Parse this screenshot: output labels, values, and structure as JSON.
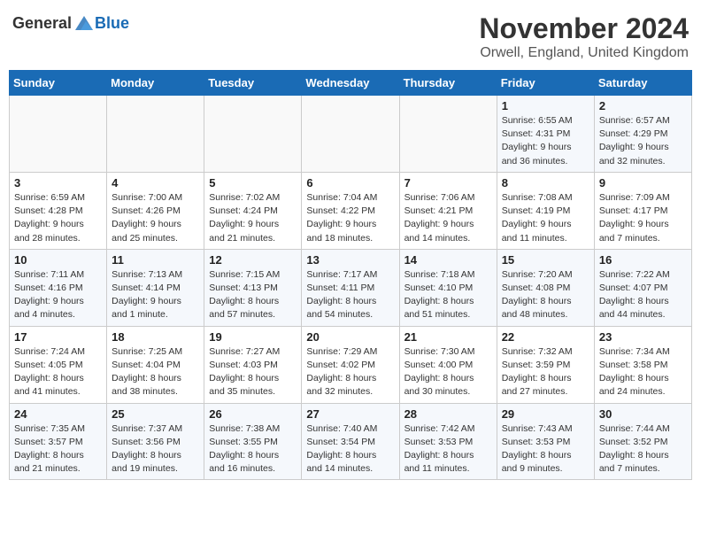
{
  "logo": {
    "text_general": "General",
    "text_blue": "Blue"
  },
  "title": "November 2024",
  "location": "Orwell, England, United Kingdom",
  "weekdays": [
    "Sunday",
    "Monday",
    "Tuesday",
    "Wednesday",
    "Thursday",
    "Friday",
    "Saturday"
  ],
  "weeks": [
    [
      {
        "day": "",
        "detail": ""
      },
      {
        "day": "",
        "detail": ""
      },
      {
        "day": "",
        "detail": ""
      },
      {
        "day": "",
        "detail": ""
      },
      {
        "day": "",
        "detail": ""
      },
      {
        "day": "1",
        "detail": "Sunrise: 6:55 AM\nSunset: 4:31 PM\nDaylight: 9 hours\nand 36 minutes."
      },
      {
        "day": "2",
        "detail": "Sunrise: 6:57 AM\nSunset: 4:29 PM\nDaylight: 9 hours\nand 32 minutes."
      }
    ],
    [
      {
        "day": "3",
        "detail": "Sunrise: 6:59 AM\nSunset: 4:28 PM\nDaylight: 9 hours\nand 28 minutes."
      },
      {
        "day": "4",
        "detail": "Sunrise: 7:00 AM\nSunset: 4:26 PM\nDaylight: 9 hours\nand 25 minutes."
      },
      {
        "day": "5",
        "detail": "Sunrise: 7:02 AM\nSunset: 4:24 PM\nDaylight: 9 hours\nand 21 minutes."
      },
      {
        "day": "6",
        "detail": "Sunrise: 7:04 AM\nSunset: 4:22 PM\nDaylight: 9 hours\nand 18 minutes."
      },
      {
        "day": "7",
        "detail": "Sunrise: 7:06 AM\nSunset: 4:21 PM\nDaylight: 9 hours\nand 14 minutes."
      },
      {
        "day": "8",
        "detail": "Sunrise: 7:08 AM\nSunset: 4:19 PM\nDaylight: 9 hours\nand 11 minutes."
      },
      {
        "day": "9",
        "detail": "Sunrise: 7:09 AM\nSunset: 4:17 PM\nDaylight: 9 hours\nand 7 minutes."
      }
    ],
    [
      {
        "day": "10",
        "detail": "Sunrise: 7:11 AM\nSunset: 4:16 PM\nDaylight: 9 hours\nand 4 minutes."
      },
      {
        "day": "11",
        "detail": "Sunrise: 7:13 AM\nSunset: 4:14 PM\nDaylight: 9 hours\nand 1 minute."
      },
      {
        "day": "12",
        "detail": "Sunrise: 7:15 AM\nSunset: 4:13 PM\nDaylight: 8 hours\nand 57 minutes."
      },
      {
        "day": "13",
        "detail": "Sunrise: 7:17 AM\nSunset: 4:11 PM\nDaylight: 8 hours\nand 54 minutes."
      },
      {
        "day": "14",
        "detail": "Sunrise: 7:18 AM\nSunset: 4:10 PM\nDaylight: 8 hours\nand 51 minutes."
      },
      {
        "day": "15",
        "detail": "Sunrise: 7:20 AM\nSunset: 4:08 PM\nDaylight: 8 hours\nand 48 minutes."
      },
      {
        "day": "16",
        "detail": "Sunrise: 7:22 AM\nSunset: 4:07 PM\nDaylight: 8 hours\nand 44 minutes."
      }
    ],
    [
      {
        "day": "17",
        "detail": "Sunrise: 7:24 AM\nSunset: 4:05 PM\nDaylight: 8 hours\nand 41 minutes."
      },
      {
        "day": "18",
        "detail": "Sunrise: 7:25 AM\nSunset: 4:04 PM\nDaylight: 8 hours\nand 38 minutes."
      },
      {
        "day": "19",
        "detail": "Sunrise: 7:27 AM\nSunset: 4:03 PM\nDaylight: 8 hours\nand 35 minutes."
      },
      {
        "day": "20",
        "detail": "Sunrise: 7:29 AM\nSunset: 4:02 PM\nDaylight: 8 hours\nand 32 minutes."
      },
      {
        "day": "21",
        "detail": "Sunrise: 7:30 AM\nSunset: 4:00 PM\nDaylight: 8 hours\nand 30 minutes."
      },
      {
        "day": "22",
        "detail": "Sunrise: 7:32 AM\nSunset: 3:59 PM\nDaylight: 8 hours\nand 27 minutes."
      },
      {
        "day": "23",
        "detail": "Sunrise: 7:34 AM\nSunset: 3:58 PM\nDaylight: 8 hours\nand 24 minutes."
      }
    ],
    [
      {
        "day": "24",
        "detail": "Sunrise: 7:35 AM\nSunset: 3:57 PM\nDaylight: 8 hours\nand 21 minutes."
      },
      {
        "day": "25",
        "detail": "Sunrise: 7:37 AM\nSunset: 3:56 PM\nDaylight: 8 hours\nand 19 minutes."
      },
      {
        "day": "26",
        "detail": "Sunrise: 7:38 AM\nSunset: 3:55 PM\nDaylight: 8 hours\nand 16 minutes."
      },
      {
        "day": "27",
        "detail": "Sunrise: 7:40 AM\nSunset: 3:54 PM\nDaylight: 8 hours\nand 14 minutes."
      },
      {
        "day": "28",
        "detail": "Sunrise: 7:42 AM\nSunset: 3:53 PM\nDaylight: 8 hours\nand 11 minutes."
      },
      {
        "day": "29",
        "detail": "Sunrise: 7:43 AM\nSunset: 3:53 PM\nDaylight: 8 hours\nand 9 minutes."
      },
      {
        "day": "30",
        "detail": "Sunrise: 7:44 AM\nSunset: 3:52 PM\nDaylight: 8 hours\nand 7 minutes."
      }
    ]
  ]
}
